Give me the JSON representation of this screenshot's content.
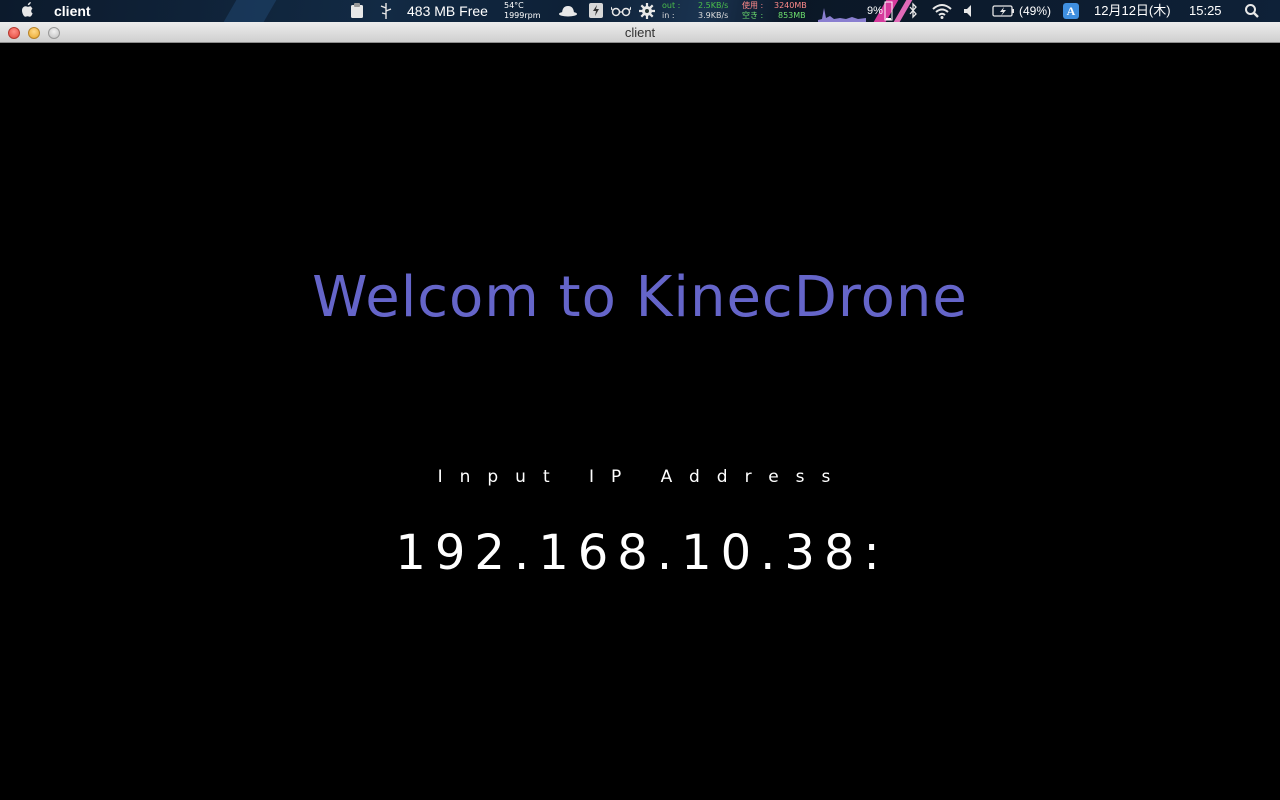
{
  "menubar": {
    "app_name": "client",
    "memory": "483 MB Free",
    "temperature": "54°C",
    "fan_speed": "1999rpm",
    "net_out_label": "out :",
    "net_in_label": "in :",
    "net_out": "2.5KB/s",
    "net_in": "3.9KB/s",
    "mem_used_label": "使用 :",
    "mem_free_label": "空き :",
    "mem_used": "3240MB",
    "mem_free": "853MB",
    "cpu_percent": "9%",
    "battery": "(49%)",
    "input_method": "A",
    "date": "12月12日(木)",
    "time": "15:25"
  },
  "window": {
    "title": "client"
  },
  "content": {
    "welcome": "Welcom to KinecDrone",
    "prompt": "Input IP Address",
    "ip_value": "192.168.10.38:"
  },
  "colors": {
    "welcome_text": "#6565c9",
    "background": "#000000",
    "accent_streak": "#d63a9c"
  }
}
